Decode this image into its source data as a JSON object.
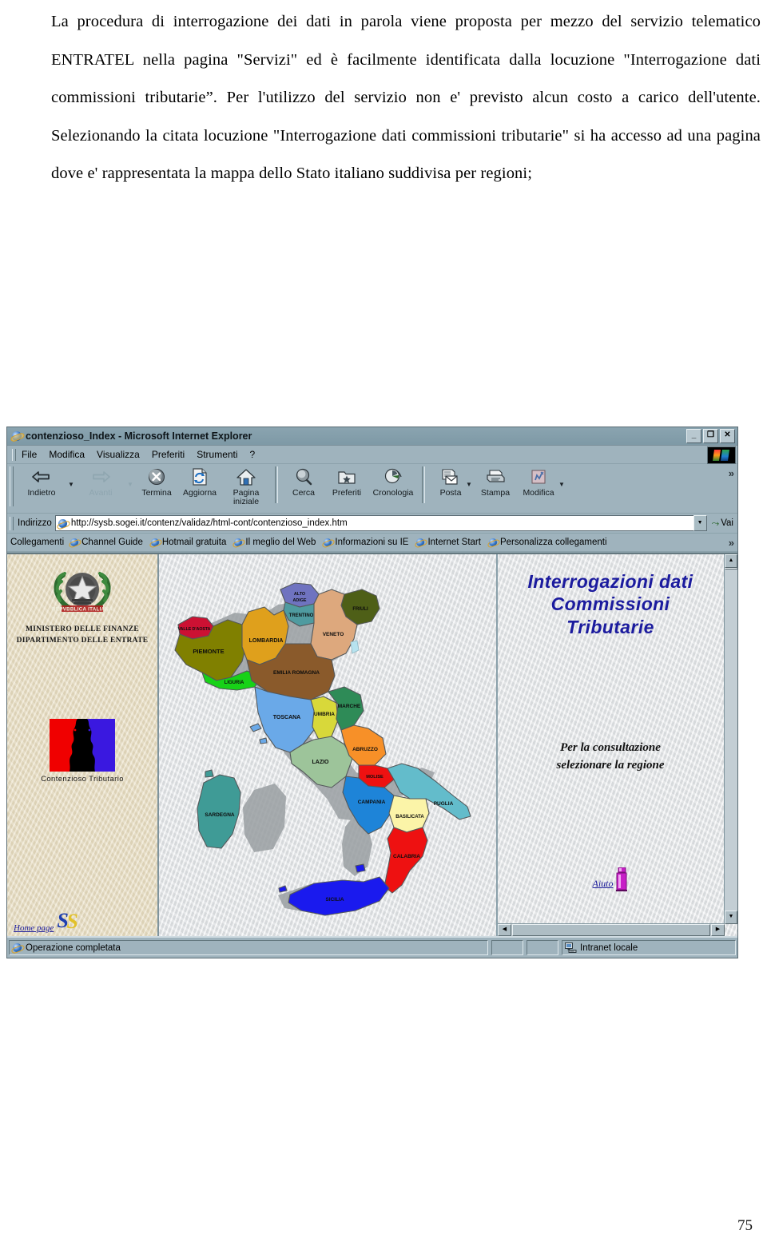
{
  "document": {
    "paragraphs": [
      "La procedura di interrogazione dei dati in parola viene proposta per mezzo del servizio telematico  ENTRATEL  nella pagina \"Servizi\" ed è facilmente identificata dalla locuzione \"Interrogazione dati commissioni tributarie”. Per l'utilizzo del  servizio non  e' previsto alcun costo a carico dell'utente. Selezionando la citata locuzione \"Interrogazione dati commissioni tributarie\" si ha accesso   ad una pagina dove e' rappresentata la mappa dello Stato italiano suddivisa per regioni;"
    ],
    "page_number": "75"
  },
  "browser": {
    "title": "contenzioso_Index - Microsoft Internet Explorer",
    "window_buttons": {
      "minimize": "_",
      "restore": "❐",
      "close": "✕"
    },
    "menu": [
      {
        "label": "File",
        "accel": "F"
      },
      {
        "label": "Modifica",
        "accel": "M"
      },
      {
        "label": "Visualizza",
        "accel": "V"
      },
      {
        "label": "Preferiti",
        "accel": "P"
      },
      {
        "label": "Strumenti",
        "accel": "S"
      },
      {
        "label": "?",
        "accel": "?"
      }
    ],
    "toolbar": [
      {
        "label": "Indietro",
        "icon": "back-arrow-icon",
        "disabled": false,
        "dropdown": true
      },
      {
        "label": "Avanti",
        "icon": "forward-arrow-icon",
        "disabled": true,
        "dropdown": true
      },
      {
        "label": "Termina",
        "icon": "stop-icon",
        "disabled": false,
        "dropdown": false
      },
      {
        "label": "Aggiorna",
        "icon": "refresh-icon",
        "disabled": false,
        "dropdown": false
      },
      {
        "label": "Pagina iniziale",
        "icon": "home-icon",
        "disabled": false,
        "dropdown": false
      },
      {
        "label": "Cerca",
        "icon": "search-icon",
        "disabled": false,
        "dropdown": false
      },
      {
        "label": "Preferiti",
        "icon": "favorites-folder-icon",
        "disabled": false,
        "dropdown": false
      },
      {
        "label": "Cronologia",
        "icon": "history-clock-icon",
        "disabled": false,
        "dropdown": false
      },
      {
        "label": "Posta",
        "icon": "mail-icon",
        "disabled": false,
        "dropdown": true
      },
      {
        "label": "Stampa",
        "icon": "printer-icon",
        "disabled": false,
        "dropdown": false
      },
      {
        "label": "Modifica",
        "icon": "edit-page-icon",
        "disabled": false,
        "dropdown": true
      }
    ],
    "toolbar_overflow": "»",
    "address": {
      "label": "Indirizzo",
      "value": "http://sysb.sogei.it/contenz/validaz/html-cont/contenzioso_index.htm",
      "go_label": "Vai"
    },
    "links": {
      "label": "Collegamenti",
      "items": [
        "Channel Guide",
        "Hotmail gratuita",
        "Il meglio del Web",
        "Informazioni su IE",
        "Internet Start",
        "Personalizza collegamenti"
      ],
      "overflow": "»"
    },
    "status": {
      "message": "Operazione completata",
      "zone": "Intranet locale"
    }
  },
  "page": {
    "sidebar": {
      "emblem_caption": "REPUBBLICA ITALIANA",
      "ministry_line1": "MINISTERO DELLE FINANZE",
      "ministry_line2": "DIPARTIMENTO DELLE ENTRATE",
      "logo_caption": "Contenzioso Tributario",
      "home_link": "Home page",
      "vendor_mark": "S"
    },
    "content": {
      "heading_line1": "Interrogazioni dati",
      "heading_line2": "Commissioni",
      "heading_line3": "Tributarie",
      "heading_color": "#1b1b9e",
      "instruction_line1": "Per la consultazione",
      "instruction_line2": "selezionare la regione",
      "help_link": "Aiuto",
      "help_icon": "info-i-icon"
    },
    "map": {
      "title": "Mappa dello Stato italiano suddivisa per regioni",
      "regions": [
        {
          "name": "VALLE D'AOSTA",
          "color": "#cc1133"
        },
        {
          "name": "PIEMONTE",
          "color": "#808000"
        },
        {
          "name": "LOMBARDIA",
          "color": "#dfa01c"
        },
        {
          "name": "LIGURIA",
          "color": "#17d217"
        },
        {
          "name": "ALTO ADIGE",
          "color": "#6f73c0"
        },
        {
          "name": "TRENTINO",
          "color": "#4f9ba0"
        },
        {
          "name": "FRIULI",
          "color": "#4e5f17"
        },
        {
          "name": "VENETO",
          "color": "#dda87d"
        },
        {
          "name": "EMILIA ROMAGNA",
          "color": "#8a5a2b"
        },
        {
          "name": "TOSCANA",
          "color": "#6aa9e8"
        },
        {
          "name": "UMBRIA",
          "color": "#d8d83a"
        },
        {
          "name": "MARCHE",
          "color": "#2e8b57"
        },
        {
          "name": "LAZIO",
          "color": "#9dc49a"
        },
        {
          "name": "ABRUZZO",
          "color": "#f79028"
        },
        {
          "name": "MOLISE",
          "color": "#ee1111"
        },
        {
          "name": "CAMPANIA",
          "color": "#1e84d8"
        },
        {
          "name": "PUGLIA",
          "color": "#63bccb"
        },
        {
          "name": "BASILICATA",
          "color": "#fbf4a8"
        },
        {
          "name": "CALABRIA",
          "color": "#ee1111"
        },
        {
          "name": "SICILIA",
          "color": "#1a1aee"
        },
        {
          "name": "SARDEGNA",
          "color": "#3f9b96"
        }
      ]
    }
  }
}
